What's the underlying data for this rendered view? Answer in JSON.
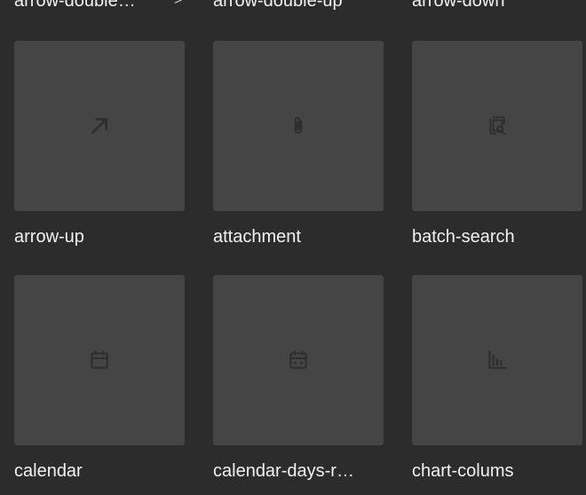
{
  "top_row": {
    "labels": [
      "arrow-double…",
      "arrow-double-up",
      "arrow-down"
    ],
    "chevron": ">"
  },
  "icons": [
    {
      "name": "arrow-up",
      "icon": "arrow-up-right-icon"
    },
    {
      "name": "attachment",
      "icon": "paperclip-icon"
    },
    {
      "name": "batch-search",
      "icon": "batch-search-icon"
    },
    {
      "name": "calendar",
      "icon": "calendar-icon"
    },
    {
      "name": "calendar-days-r…",
      "icon": "calendar-days-icon"
    },
    {
      "name": "chart-colums",
      "icon": "bar-chart-icon"
    }
  ],
  "colors": {
    "background": "#2c2c2c",
    "tile": "#454545",
    "icon": "#2e2e2e",
    "text": "#f2f2f2"
  }
}
